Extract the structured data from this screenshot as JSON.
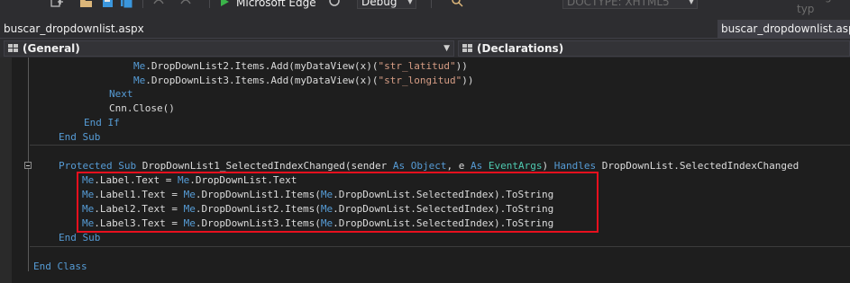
{
  "toolbar": {
    "browser_label": "Microsoft Edge",
    "config_value": "Debug",
    "doctype_value": "DOCTYPE: XHTML5",
    "change_type_label": "Change typ"
  },
  "tabs": {
    "file_tab_left": "buscar_dropdownlist.aspx",
    "file_tab_right": "buscar_dropdownlist.aspx.v"
  },
  "navbar": {
    "left_combo": "(General)",
    "right_combo": "(Declarations)"
  },
  "code": {
    "line1_pre": "Me",
    "line1_mid": ".DropDownList2.Items.Add(myDataView(x)(",
    "line1_str": "\"str_latitud\"",
    "line1_end": "))",
    "line2_pre": "Me",
    "line2_mid": ".DropDownList3.Items.Add(myDataView(x)(",
    "line2_str": "\"str_longitud\"",
    "line2_end": "))",
    "next": "Next",
    "cnn_close": "Cnn.Close()",
    "end_if": "End If",
    "end_sub_1": "End Sub",
    "sub_protected": "Protected",
    "sub_sub": "Sub",
    "sub_name": " DropDownList1_SelectedIndexChanged(sender ",
    "sub_as1": "As",
    "sub_object": "Object",
    "sub_comma": ", e ",
    "sub_as2": "As",
    "sub_eventargs": "EventArgs",
    "sub_close": ") ",
    "sub_handles": "Handles",
    "sub_handled": " DropDownList.SelectedIndexChanged",
    "hl1_me": "Me",
    "hl1_a": ".Label.Text = ",
    "hl1_me2": "Me",
    "hl1_b": ".DropDownList.Text",
    "hl2_me": "Me",
    "hl2_a": ".Label1.Text = ",
    "hl2_me2": "Me",
    "hl2_b": ".DropDownList1.Items(",
    "hl2_me3": "Me",
    "hl2_c": ".DropDownList.SelectedIndex).ToString",
    "hl3_me": "Me",
    "hl3_a": ".Label2.Text = ",
    "hl3_me2": "Me",
    "hl3_b": ".DropDownList2.Items(",
    "hl3_me3": "Me",
    "hl3_c": ".DropDownList.SelectedIndex).ToString",
    "hl4_me": "Me",
    "hl4_a": ".Label3.Text = ",
    "hl4_me2": "Me",
    "hl4_b": ".DropDownList3.Items(",
    "hl4_me3": "Me",
    "hl4_c": ".DropDownList.SelectedIndex).ToString",
    "end_sub_2": "End Sub",
    "end_class": "End Class"
  },
  "colors": {
    "keyword": "#569cd6",
    "string": "#d69d85",
    "type": "#4ec9b0",
    "highlight_border": "#e8101e"
  },
  "icons": [
    "new-project-icon",
    "open-folder-icon",
    "save-icon",
    "save-all-icon",
    "undo-icon",
    "redo-icon",
    "start-debug-icon",
    "refresh-icon",
    "find-icon",
    "class-icon"
  ]
}
